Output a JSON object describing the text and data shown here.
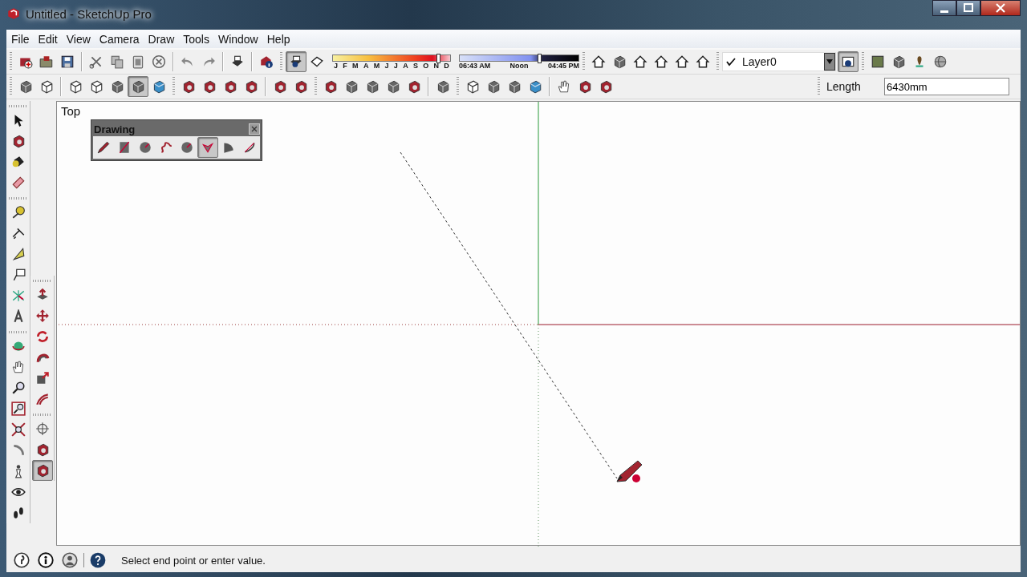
{
  "window": {
    "title": "Untitled - SketchUp Pro"
  },
  "menu": [
    "File",
    "Edit",
    "View",
    "Camera",
    "Draw",
    "Tools",
    "Window",
    "Help"
  ],
  "toolbar_top": [
    [
      {
        "selected": false
      },
      {
        "selected": false
      },
      {
        "selected": false
      }
    ],
    [
      {
        "selected": false
      },
      {
        "selected": false
      },
      {
        "selected": false
      },
      {
        "selected": false
      }
    ],
    [
      {
        "selected": false
      },
      {
        "selected": false
      }
    ],
    [
      {
        "selected": false
      }
    ],
    [
      {
        "selected": false
      }
    ],
    [
      {
        "selected": true
      },
      {
        "selected": false
      }
    ]
  ],
  "shadows": {
    "months": [
      "J",
      "F",
      "M",
      "A",
      "M",
      "J",
      "J",
      "A",
      "S",
      "O",
      "N",
      "D"
    ],
    "month_slider": {
      "level": 0.9
    },
    "times": [
      "06:43 AM",
      "Noon",
      "04:45 PM"
    ],
    "time_slider": {
      "level": 0.67
    }
  },
  "views_toolbar": [
    {
      "selected": false
    },
    {
      "selected": false
    },
    {
      "selected": false
    },
    {
      "selected": false
    },
    {
      "selected": false
    },
    {
      "selected": false
    }
  ],
  "layers": {
    "checked": true,
    "value": "Layer0"
  },
  "toolbar_right": [
    {
      "selected": false
    },
    {
      "selected": false
    },
    {
      "selected": false
    },
    {
      "selected": false
    }
  ],
  "toolbar_second": [
    [
      {
        "selected": false
      },
      {
        "selected": false
      }
    ],
    [
      {
        "selected": false
      },
      {
        "selected": false
      },
      {
        "selected": false
      },
      {
        "selected": true
      },
      {
        "selected": false
      }
    ],
    [
      {
        "selected": false
      },
      {
        "selected": false
      },
      {
        "selected": false
      },
      {
        "selected": false
      }
    ],
    [
      {
        "selected": false
      },
      {
        "selected": false
      }
    ],
    [
      {
        "selected": false
      },
      {
        "selected": false
      },
      {
        "selected": false
      },
      {
        "selected": false
      },
      {
        "selected": false
      }
    ],
    [
      {
        "selected": false
      }
    ],
    [
      {
        "selected": false
      },
      {
        "selected": false
      },
      {
        "selected": false
      },
      {
        "selected": false
      }
    ],
    [
      {
        "selected": false
      },
      {
        "selected": false
      },
      {
        "selected": false
      }
    ]
  ],
  "measurements": {
    "label": "Length",
    "value": "6430mm"
  },
  "left_toolbar": [
    [
      {
        "selected": false
      },
      {
        "selected": false
      },
      {
        "selected": false
      },
      {
        "selected": false
      }
    ],
    [
      {
        "selected": false
      },
      {
        "selected": false
      },
      {
        "selected": false
      },
      {
        "selected": false
      },
      {
        "selected": false
      },
      {
        "selected": false
      }
    ],
    [
      {
        "selected": false
      },
      {
        "selected": false
      },
      {
        "selected": false
      },
      {
        "selected": false
      },
      {
        "selected": false
      },
      {
        "selected": false
      },
      {
        "selected": false
      },
      {
        "selected": false
      },
      {
        "selected": false
      }
    ]
  ],
  "left_toolbar_2": [
    [
      {
        "selected": false
      },
      {
        "selected": false
      },
      {
        "selected": false
      },
      {
        "selected": false
      },
      {
        "selected": false
      },
      {
        "selected": false
      }
    ],
    [
      {
        "selected": false
      },
      {
        "selected": false
      },
      {
        "selected": true
      }
    ]
  ],
  "viewport": {
    "view_label": "Top"
  },
  "drawing_toolbar": {
    "title": "Drawing",
    "tools": [
      {
        "selected": false
      },
      {
        "selected": false
      },
      {
        "selected": false
      },
      {
        "selected": false
      },
      {
        "selected": false
      },
      {
        "selected": true
      },
      {
        "selected": false
      },
      {
        "selected": false
      }
    ]
  },
  "status_bar": {
    "message": "Select end point or enter value."
  }
}
